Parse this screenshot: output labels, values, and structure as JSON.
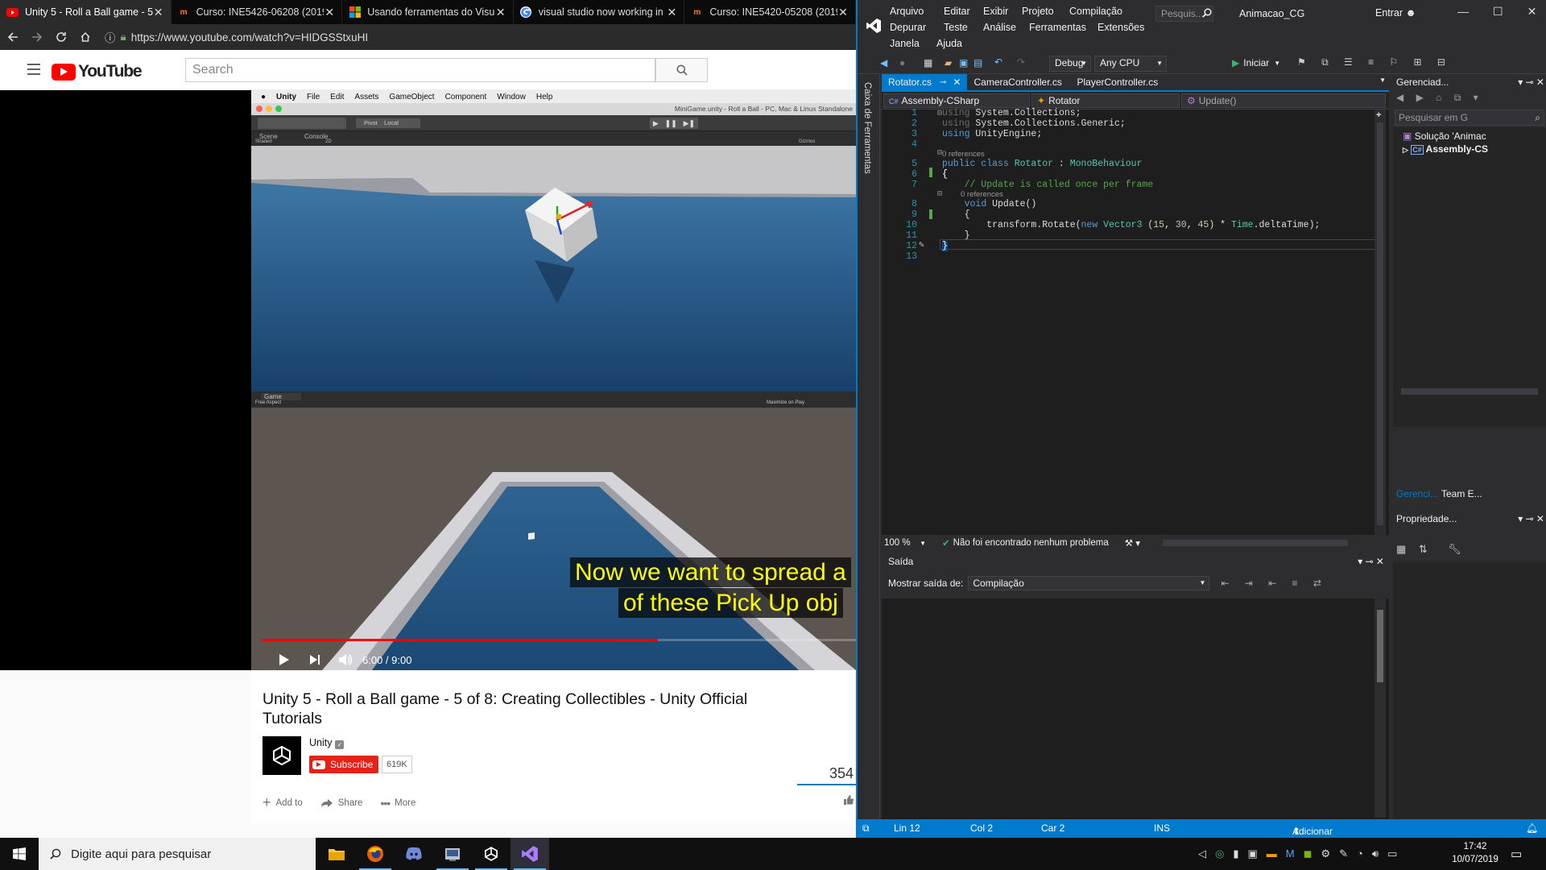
{
  "browser": {
    "tabs": [
      {
        "label": "Unity 5 - Roll a Ball game - 5",
        "favicon": "youtube-icon",
        "active": true
      },
      {
        "label": "Curso: INE5426-06208 (2019",
        "favicon": "moodle-icon",
        "active": false
      },
      {
        "label": "Usando ferramentas do Visua",
        "favicon": "microsoft-icon",
        "active": false
      },
      {
        "label": "visual studio now working in",
        "favicon": "google-icon",
        "active": false
      },
      {
        "label": "Curso: INE5420-05208 (2019",
        "favicon": "moodle-icon",
        "active": false
      }
    ],
    "url": "https://www.youtube.com/watch?v=HIDGSStxuHI"
  },
  "youtube": {
    "logo_text": "YouTube",
    "search_placeholder": "Search",
    "unity_menu": [
      "Unity",
      "File",
      "Edit",
      "Assets",
      "GameObject",
      "Component",
      "Window",
      "Help"
    ],
    "unity_title": "MiniGame.unity - Roll a Ball - PC, Mac & Linux Standalone",
    "unity_scene_tabs": [
      "Scene",
      "Console"
    ],
    "unity_pivot": "Pivot",
    "unity_local": "Local",
    "unity_scene_opts": [
      "Shaded",
      "2D"
    ],
    "unity_gizmos": "Gizmos",
    "unity_game_tab": "Game",
    "unity_free_aspect": "Free Aspect",
    "unity_maximize": "Maximize on Play",
    "caption_line1": "Now we want to spread a",
    "caption_line2": "of these Pick Up obj",
    "time": "6:00 / 9:00",
    "progress": 0.6667,
    "video_title": "Unity 5 - Roll a Ball game - 5 of 8: Creating Collectibles - Unity Official Tutorials",
    "channel": "Unity",
    "subscribe_label": "Subscribe",
    "subscriber_count": "619K",
    "views": "354",
    "actions": [
      {
        "label": "Add to",
        "icon": "plus-icon"
      },
      {
        "label": "Share",
        "icon": "share-icon"
      },
      {
        "label": "More",
        "icon": "more-icon"
      }
    ]
  },
  "vs": {
    "menu_row1": [
      "Arquivo",
      "Editar",
      "Exibir",
      "Projeto",
      "Compilação"
    ],
    "menu_row2": [
      "Depurar",
      "Teste",
      "Análise",
      "Ferramentas",
      "Extensões"
    ],
    "menu_row3": [
      "Janela",
      "Ajuda"
    ],
    "search_placeholder": "Pesquis...",
    "solution_name": "Animacao_CG",
    "signin": "Entrar",
    "config": "Debug",
    "platform": "Any CPU",
    "start_label": "Iniciar",
    "toolbox_label": "Caixa de Ferramentas",
    "doc_tabs": [
      "Rotator.cs",
      "CameraController.cs",
      "PlayerController.cs"
    ],
    "nav_project": "Assembly-CSharp",
    "nav_class": "Rotator",
    "nav_member": "Update()",
    "code_lines": [
      "using System.Collections;",
      "using System.Collections.Generic;",
      "using UnityEngine;",
      "",
      "public class Rotator : MonoBehaviour",
      "{",
      "    // Update is called once per frame",
      "    void Update()",
      "    {",
      "        transform.Rotate(new Vector3 (15, 30, 45) * Time.deltaTime);",
      "    }",
      "}",
      ""
    ],
    "refs_label": "0 references",
    "zoom": "100 %",
    "issues": "Não foi encontrado nenhum problema",
    "output_title": "Saída",
    "output_show_label": "Mostrar saída de:",
    "output_source": "Compilação",
    "solution_explorer_title": "Gerenciad...",
    "solution_search": "Pesquisar em G",
    "solution_item": "Solução 'Animac",
    "project_item": "Assembly-CS",
    "bottom_tabs": [
      "Gerenci...",
      "Team E..."
    ],
    "properties_title": "Propriedade...",
    "status": {
      "line": "Lin 12",
      "col": "Col 2",
      "car": "Car 2",
      "ins": "INS",
      "source_control": "Adicionar ao Controle do Código-Fonte"
    }
  },
  "taskbar": {
    "search_placeholder": "Digite aqui para pesquisar",
    "time": "17:42",
    "date": "10/07/2019"
  },
  "colors": {
    "vs_accent": "#007acc",
    "youtube_red": "#ff0000",
    "caption_text": "#ffff00"
  }
}
